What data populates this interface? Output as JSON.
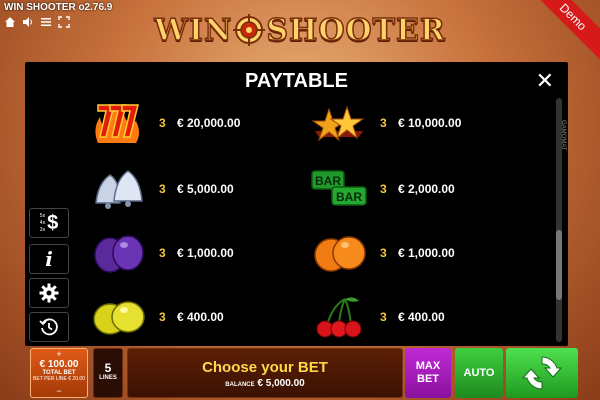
{
  "header": {
    "version": "WIN SHOOTER o2.76.9",
    "logo_left": "WIN",
    "logo_right": "SHOOTER",
    "demo": "Demo"
  },
  "paytable": {
    "title": "PAYTABLE",
    "side_label": "GAMOMAT",
    "rows": [
      {
        "symbol": "sevens-fire",
        "multiplier": "3",
        "payout": "€ 20,000.00"
      },
      {
        "symbol": "stars",
        "multiplier": "3",
        "payout": "€ 10,000.00"
      },
      {
        "symbol": "bells",
        "multiplier": "3",
        "payout": "€ 5,000.00"
      },
      {
        "symbol": "bar-bar",
        "multiplier": "3",
        "payout": "€ 2,000.00",
        "text": "BAR"
      },
      {
        "symbol": "plums",
        "multiplier": "3",
        "payout": "€ 1,000.00"
      },
      {
        "symbol": "oranges",
        "multiplier": "3",
        "payout": "€ 1,000.00"
      },
      {
        "symbol": "lemons",
        "multiplier": "3",
        "payout": "€ 400.00"
      },
      {
        "symbol": "cherries",
        "multiplier": "3",
        "payout": "€ 400.00"
      }
    ]
  },
  "side_buttons": {
    "paytable_lines": [
      "5x",
      "4x",
      "3x"
    ]
  },
  "bottom": {
    "total_bet_value": "€ 100.00",
    "total_bet_label": "TOTAL BET",
    "bet_per_line": "BET PER LINE € 20.00",
    "plus": "+",
    "minus": "−",
    "lines_value": "5",
    "lines_label": "LINES",
    "message": "Choose your BET",
    "balance_label": "BALANCE",
    "balance_value": "€ 5,000.00",
    "max_bet": "MAX BET",
    "auto": "AUTO"
  },
  "colors": {
    "accent_gold": "#ffd84a",
    "max_bet": "#c02ad6",
    "auto": "#3fcf3f",
    "demo": "#d61a1a"
  }
}
